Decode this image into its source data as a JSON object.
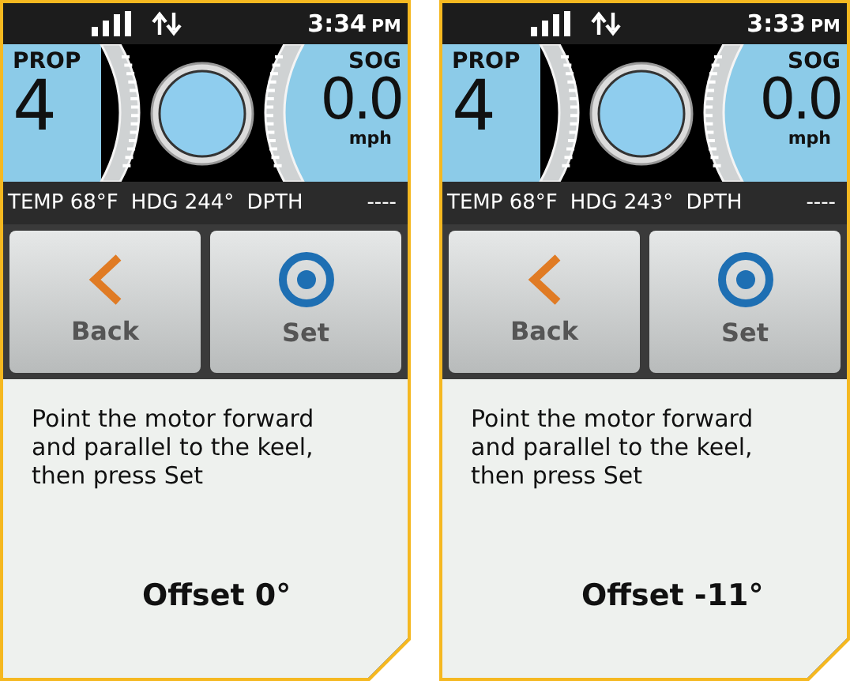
{
  "screens": [
    {
      "status": {
        "time": "3:34",
        "ampm": "PM"
      },
      "prop": {
        "label": "PROP",
        "value": "4"
      },
      "sog": {
        "label": "SOG",
        "value": "0.0",
        "unit": "mph"
      },
      "info": [
        "TEMP 68°F",
        "HDG 244°",
        "DPTH",
        "----"
      ],
      "buttons": [
        {
          "label": "Back",
          "kind": "back"
        },
        {
          "label": "Set",
          "kind": "set"
        }
      ],
      "message": "Point the motor forward and parallel to the keel, then press Set",
      "offset": "Offset 0°"
    },
    {
      "status": {
        "time": "3:33",
        "ampm": "PM"
      },
      "prop": {
        "label": "PROP",
        "value": "4"
      },
      "sog": {
        "label": "SOG",
        "value": "0.0",
        "unit": "mph"
      },
      "info": [
        "TEMP 68°F",
        "HDG 243°",
        "DPTH",
        "----"
      ],
      "buttons": [
        {
          "label": "Back",
          "kind": "back"
        },
        {
          "label": "Set",
          "kind": "set"
        }
      ],
      "message": "Point the motor forward and parallel to the keel, then press Set",
      "offset": "Offset -11°"
    }
  ]
}
